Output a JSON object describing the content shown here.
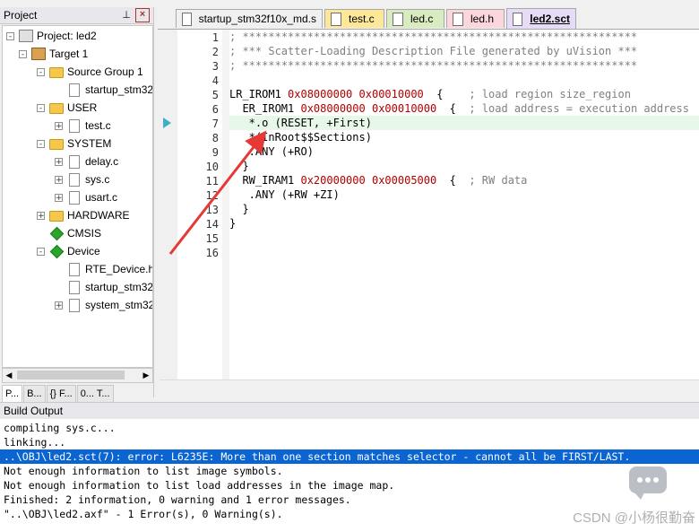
{
  "project_panel": {
    "title": "Project",
    "pin_glyph": "ᵖ",
    "close_glyph": "x",
    "tree": [
      {
        "label": "Project: led2",
        "kind": "project",
        "expander": "-"
      },
      {
        "label": "Target 1",
        "kind": "target",
        "expander": "-"
      },
      {
        "label": "Source Group 1",
        "kind": "folder",
        "expander": "-"
      },
      {
        "label": "startup_stm32f10x_md.s",
        "kind": "file",
        "expander": ""
      },
      {
        "label": "USER",
        "kind": "folder",
        "expander": "-"
      },
      {
        "label": "test.c",
        "kind": "file",
        "expander": "+"
      },
      {
        "label": "SYSTEM",
        "kind": "folder",
        "expander": "-"
      },
      {
        "label": "delay.c",
        "kind": "file",
        "expander": "+"
      },
      {
        "label": "sys.c",
        "kind": "file",
        "expander": "+"
      },
      {
        "label": "usart.c",
        "kind": "file",
        "expander": "+"
      },
      {
        "label": "HARDWARE",
        "kind": "folder",
        "expander": "+"
      },
      {
        "label": "CMSIS",
        "kind": "component",
        "expander": ""
      },
      {
        "label": "Device",
        "kind": "component",
        "expander": "-"
      },
      {
        "label": "RTE_Device.h",
        "kind": "file",
        "expander": ""
      },
      {
        "label": "startup_stm32f10x_md.s",
        "kind": "file",
        "expander": ""
      },
      {
        "label": "system_stm32f10x.c",
        "kind": "file",
        "expander": "+"
      }
    ],
    "tabs": [
      "P...",
      "B...",
      "{} F...",
      "0... T..."
    ]
  },
  "editor_tabs": [
    {
      "label": "startup_stm32f10x_md.s",
      "color": "#f0f0f0"
    },
    {
      "label": "test.c",
      "color": "#fde89a"
    },
    {
      "label": "led.c",
      "color": "#d9ecc0"
    },
    {
      "label": "led.h",
      "color": "#fbd6dc"
    },
    {
      "label": "led2.sct",
      "color": "#e6dcf5"
    }
  ],
  "editor": {
    "current_line": 7,
    "line_numbers": [
      "1",
      "2",
      "3",
      "4",
      "5",
      "6",
      "7",
      "8",
      "9",
      "10",
      "11",
      "12",
      "13",
      "14",
      "15",
      "16"
    ],
    "lines": [
      {
        "n": 1,
        "parts": [
          {
            "t": "; *************************************************************",
            "c": "cm"
          }
        ]
      },
      {
        "n": 2,
        "parts": [
          {
            "t": "; *** Scatter-Loading Description File generated by uVision ***",
            "c": "cm"
          }
        ]
      },
      {
        "n": 3,
        "parts": [
          {
            "t": "; *************************************************************",
            "c": "cm"
          }
        ]
      },
      {
        "n": 4,
        "parts": []
      },
      {
        "n": 5,
        "parts": [
          {
            "t": "LR_IROM1 ",
            "c": ""
          },
          {
            "t": "0x08000000",
            "c": "hex"
          },
          {
            "t": " ",
            "c": ""
          },
          {
            "t": "0x00010000",
            "c": "hex"
          },
          {
            "t": "  {    ",
            "c": ""
          },
          {
            "t": "; load region size_region",
            "c": "cm"
          }
        ]
      },
      {
        "n": 6,
        "parts": [
          {
            "t": "  ER_IROM1 ",
            "c": ""
          },
          {
            "t": "0x08000000",
            "c": "hex"
          },
          {
            "t": " ",
            "c": ""
          },
          {
            "t": "0x00010000",
            "c": "hex"
          },
          {
            "t": "  {  ",
            "c": ""
          },
          {
            "t": "; load address = execution address",
            "c": "cm"
          }
        ]
      },
      {
        "n": 7,
        "parts": [
          {
            "t": "   *.o (RESET, +First)",
            "c": ""
          }
        ]
      },
      {
        "n": 8,
        "parts": [
          {
            "t": "   *(InRoot$$Sections)",
            "c": ""
          }
        ]
      },
      {
        "n": 9,
        "parts": [
          {
            "t": "   .ANY (+RO)",
            "c": ""
          }
        ]
      },
      {
        "n": 10,
        "parts": [
          {
            "t": "  }",
            "c": ""
          }
        ]
      },
      {
        "n": 11,
        "parts": [
          {
            "t": "  RW_IRAM1 ",
            "c": ""
          },
          {
            "t": "0x20000000",
            "c": "hex"
          },
          {
            "t": " ",
            "c": ""
          },
          {
            "t": "0x00005000",
            "c": "hex"
          },
          {
            "t": "  {  ",
            "c": ""
          },
          {
            "t": "; RW data",
            "c": "cm"
          }
        ]
      },
      {
        "n": 12,
        "parts": [
          {
            "t": "   .ANY (+RW +ZI)",
            "c": ""
          }
        ]
      },
      {
        "n": 13,
        "parts": [
          {
            "t": "  }",
            "c": ""
          }
        ]
      },
      {
        "n": 14,
        "parts": [
          {
            "t": "}",
            "c": ""
          }
        ]
      },
      {
        "n": 15,
        "parts": []
      },
      {
        "n": 16,
        "parts": []
      }
    ]
  },
  "build_output": {
    "title": "Build Output",
    "lines": [
      {
        "text": "compiling sys.c...",
        "error": false
      },
      {
        "text": "linking...",
        "error": false
      },
      {
        "text": "..\\OBJ\\led2.sct(7): error: L6235E: More than one section matches selector - cannot all be FIRST/LAST.",
        "error": true
      },
      {
        "text": "Not enough information to list image symbols.",
        "error": false
      },
      {
        "text": "Not enough information to list load addresses in the image map.",
        "error": false
      },
      {
        "text": "Finished: 2 information, 0 warning and 1 error messages.",
        "error": false
      },
      {
        "text": "\"..\\OBJ\\led2.axf\" - 1 Error(s), 0 Warning(s).",
        "error": false
      }
    ]
  },
  "watermark": "CSDN @小杨很勤奋",
  "colors": {
    "error_highlight": "#0a64d2",
    "current_line": "#e8f8e8",
    "hex_literal": "#b00000",
    "annotation_arrow": "#e53935"
  }
}
